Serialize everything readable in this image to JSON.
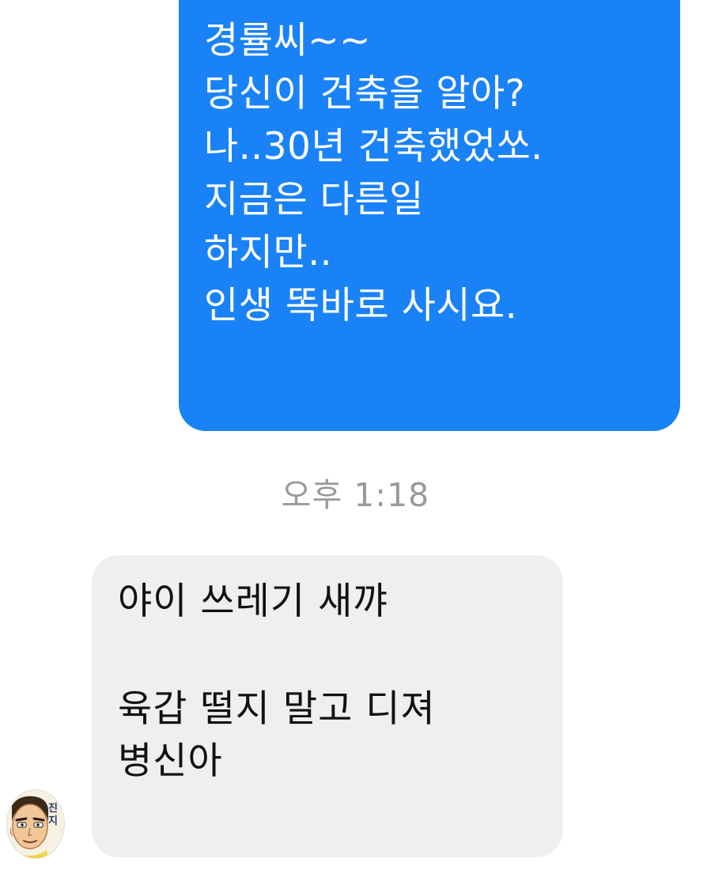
{
  "outgoing_message": {
    "lines": [
      "경률씨~~",
      "당신이 건축을 알아?",
      "나..30년 건축했었쏘.",
      "지금은 다른일",
      "하지만..",
      "인생 똑바로 사시요."
    ]
  },
  "timestamp": "오후 1:18",
  "incoming_message": {
    "lines": [
      "야이 쓰레기 새꺄",
      "육갑 떨지 말고 디져",
      "병신아"
    ]
  },
  "avatar": {
    "icon": "cartoon-face-avatar",
    "text_line_1": "진",
    "text_line_2": "지"
  },
  "colors": {
    "outgoing_bubble": "#1a82f7",
    "incoming_bubble": "#efefef",
    "timestamp_text": "#9a9a9a"
  }
}
